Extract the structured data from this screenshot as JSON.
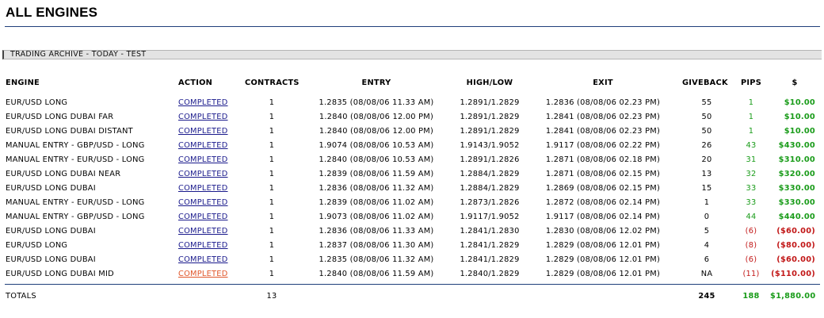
{
  "page": {
    "title": "ALL ENGINES",
    "archive_label": "TRADING ARCHIVE - TODAY - TEST"
  },
  "colors": {
    "rule": "#1f3f7a",
    "link": "#1a1a8c",
    "link_hover": "#e0562a",
    "positive": "#1a9c1a",
    "negative": "#c21818"
  },
  "table": {
    "headers": {
      "engine": "ENGINE",
      "action": "ACTION",
      "contracts": "CONTRACTS",
      "entry": "ENTRY",
      "highlow": "HIGH/LOW",
      "exit": "EXIT",
      "giveback": "GIVEBACK",
      "pips": "PIPS",
      "usd": "$"
    },
    "rows": [
      {
        "engine": "EUR/USD LONG",
        "action": "COMPLETED",
        "contracts": "1",
        "entry": "1.2835 (08/08/06 11.33 AM)",
        "highlow": "1.2891/1.2829",
        "exit": "1.2836 (08/08/06 02.23 PM)",
        "giveback": "55",
        "pips": "1",
        "usd": "$10.00"
      },
      {
        "engine": "EUR/USD LONG DUBAI FAR",
        "action": "COMPLETED",
        "contracts": "1",
        "entry": "1.2840 (08/08/06 12.00 PM)",
        "highlow": "1.2891/1.2829",
        "exit": "1.2841 (08/08/06 02.23 PM)",
        "giveback": "50",
        "pips": "1",
        "usd": "$10.00"
      },
      {
        "engine": "EUR/USD LONG DUBAI DISTANT",
        "action": "COMPLETED",
        "contracts": "1",
        "entry": "1.2840 (08/08/06 12.00 PM)",
        "highlow": "1.2891/1.2829",
        "exit": "1.2841 (08/08/06 02.23 PM)",
        "giveback": "50",
        "pips": "1",
        "usd": "$10.00"
      },
      {
        "engine": "MANUAL ENTRY - GBP/USD - LONG",
        "action": "COMPLETED",
        "contracts": "1",
        "entry": "1.9074 (08/08/06 10.53 AM)",
        "highlow": "1.9143/1.9052",
        "exit": "1.9117 (08/08/06 02.22 PM)",
        "giveback": "26",
        "pips": "43",
        "usd": "$430.00"
      },
      {
        "engine": "MANUAL ENTRY - EUR/USD - LONG",
        "action": "COMPLETED",
        "contracts": "1",
        "entry": "1.2840 (08/08/06 10.53 AM)",
        "highlow": "1.2891/1.2826",
        "exit": "1.2871 (08/08/06 02.18 PM)",
        "giveback": "20",
        "pips": "31",
        "usd": "$310.00"
      },
      {
        "engine": "EUR/USD LONG DUBAI NEAR",
        "action": "COMPLETED",
        "contracts": "1",
        "entry": "1.2839 (08/08/06 11.59 AM)",
        "highlow": "1.2884/1.2829",
        "exit": "1.2871 (08/08/06 02.15 PM)",
        "giveback": "13",
        "pips": "32",
        "usd": "$320.00"
      },
      {
        "engine": "EUR/USD LONG DUBAI",
        "action": "COMPLETED",
        "contracts": "1",
        "entry": "1.2836 (08/08/06 11.32 AM)",
        "highlow": "1.2884/1.2829",
        "exit": "1.2869 (08/08/06 02.15 PM)",
        "giveback": "15",
        "pips": "33",
        "usd": "$330.00"
      },
      {
        "engine": "MANUAL ENTRY - EUR/USD - LONG",
        "action": "COMPLETED",
        "contracts": "1",
        "entry": "1.2839 (08/08/06 11.02 AM)",
        "highlow": "1.2873/1.2826",
        "exit": "1.2872 (08/08/06 02.14 PM)",
        "giveback": "1",
        "pips": "33",
        "usd": "$330.00"
      },
      {
        "engine": "MANUAL ENTRY - GBP/USD - LONG",
        "action": "COMPLETED",
        "contracts": "1",
        "entry": "1.9073 (08/08/06 11.02 AM)",
        "highlow": "1.9117/1.9052",
        "exit": "1.9117 (08/08/06 02.14 PM)",
        "giveback": "0",
        "pips": "44",
        "usd": "$440.00"
      },
      {
        "engine": "EUR/USD LONG DUBAI",
        "action": "COMPLETED",
        "contracts": "1",
        "entry": "1.2836 (08/08/06 11.33 AM)",
        "highlow": "1.2841/1.2830",
        "exit": "1.2830 (08/08/06 12.02 PM)",
        "giveback": "5",
        "pips": "(6)",
        "usd": "($60.00)"
      },
      {
        "engine": "EUR/USD LONG",
        "action": "COMPLETED",
        "contracts": "1",
        "entry": "1.2837 (08/08/06 11.30 AM)",
        "highlow": "1.2841/1.2829",
        "exit": "1.2829 (08/08/06 12.01 PM)",
        "giveback": "4",
        "pips": "(8)",
        "usd": "($80.00)"
      },
      {
        "engine": "EUR/USD LONG DUBAI",
        "action": "COMPLETED",
        "contracts": "1",
        "entry": "1.2835 (08/08/06 11.32 AM)",
        "highlow": "1.2841/1.2829",
        "exit": "1.2829 (08/08/06 12.01 PM)",
        "giveback": "6",
        "pips": "(6)",
        "usd": "($60.00)"
      },
      {
        "engine": "EUR/USD LONG DUBAI MID",
        "action": "COMPLETED",
        "contracts": "1",
        "entry": "1.2840 (08/08/06 11.59 AM)",
        "highlow": "1.2840/1.2829",
        "exit": "1.2829 (08/08/06 12.01 PM)",
        "giveback": "NA",
        "pips": "(11)",
        "usd": "($110.00)"
      }
    ],
    "totals": {
      "label": "TOTALS",
      "contracts": "13",
      "giveback": "245",
      "pips": "188",
      "usd": "$1,880.00"
    }
  }
}
